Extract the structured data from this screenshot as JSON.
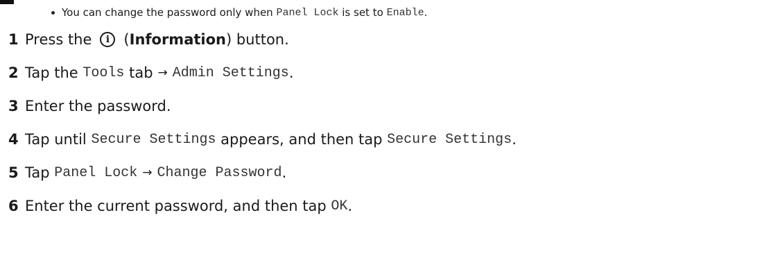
{
  "note": {
    "t1": "You can change the password only when",
    "c1": "Panel Lock",
    "t2": "is set to",
    "c2": "Enable",
    "t3": "."
  },
  "steps": [
    {
      "num": "1",
      "t1": "Press the",
      "icon": "info-icon",
      "t2": "(",
      "bold": "Information",
      "t3": ") button."
    },
    {
      "num": "2",
      "t1": "Tap the",
      "c1": "Tools",
      "t2": "tab",
      "arrow": "→",
      "c2": "Admin Settings",
      "t3": "."
    },
    {
      "num": "3",
      "t1": "Enter the password."
    },
    {
      "num": "4",
      "t1": "Tap until",
      "c1": "Secure Settings",
      "t2": "appears, and then tap",
      "c2": "Secure Settings",
      "t3": "."
    },
    {
      "num": "5",
      "t1": "Tap",
      "c1": "Panel Lock",
      "arrow": "→",
      "c2": "Change Password",
      "t2": "."
    },
    {
      "num": "6",
      "t1": "Enter the current password, and then tap",
      "c1": "OK",
      "t2": "."
    }
  ]
}
